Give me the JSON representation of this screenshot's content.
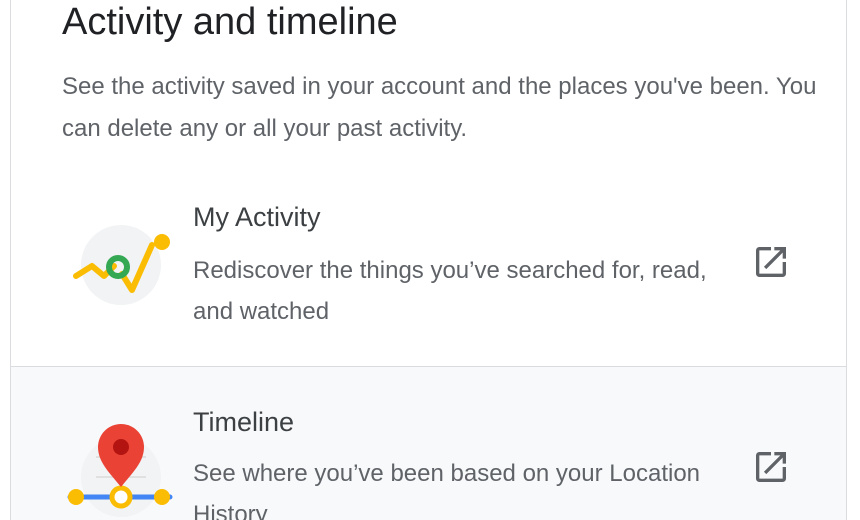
{
  "section": {
    "title": "Activity and timeline",
    "description": "See the activity saved in your account and the places you've been. You can delete any or all your past activity."
  },
  "items": [
    {
      "title": "My Activity",
      "description": "Rediscover the things you’ve searched for, read, and watched",
      "icon": "my-activity-icon",
      "action_icon": "open-in-new-icon"
    },
    {
      "title": "Timeline",
      "description": "See where you’ve been based on your Location History",
      "icon": "timeline-icon",
      "action_icon": "open-in-new-icon"
    }
  ],
  "colors": {
    "title": "#202124",
    "text": "#5f6368",
    "border": "#dadce0",
    "hover_row": "#f8f9fa",
    "yellow": "#fbbc04",
    "green": "#34a853",
    "red": "#ea4335",
    "blue": "#4285f4"
  }
}
